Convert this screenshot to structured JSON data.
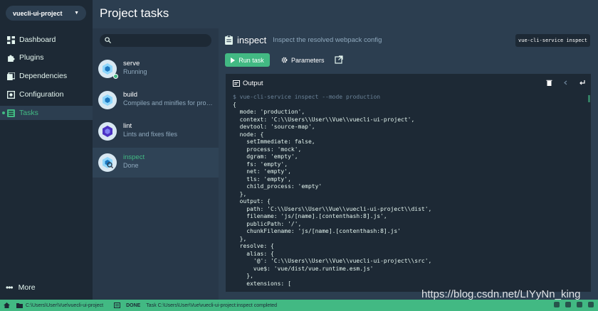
{
  "nav": {
    "project": "vuecli-ui-project",
    "items": [
      {
        "label": "Dashboard",
        "icon": "dashboard-icon"
      },
      {
        "label": "Plugins",
        "icon": "puzzle-icon"
      },
      {
        "label": "Dependencies",
        "icon": "book-icon"
      },
      {
        "label": "Configuration",
        "icon": "settings-icon"
      },
      {
        "label": "Tasks",
        "icon": "tasks-icon",
        "active": true
      }
    ],
    "more": "More"
  },
  "header": {
    "title": "Project tasks"
  },
  "tasks": [
    {
      "name": "serve",
      "desc": "Running"
    },
    {
      "name": "build",
      "desc": "Compiles and minifies for production"
    },
    {
      "name": "lint",
      "desc": "Lints and fixes files"
    },
    {
      "name": "inspect",
      "desc": "Done",
      "selected": true
    }
  ],
  "detail": {
    "name": "inspect",
    "desc": "Inspect the resolved webpack config",
    "command": "vue-cli-service inspect",
    "run_label": "Run task",
    "params_label": "Parameters",
    "output_label": "Output",
    "console": [
      "$ vue-cli-service inspect --mode production",
      "{",
      "  mode: 'production',",
      "  context: 'C:\\\\Users\\\\User\\\\Vue\\\\vuecli-ui-project',",
      "  devtool: 'source-map',",
      "  node: {",
      "    setImmediate: false,",
      "    process: 'mock',",
      "    dgram: 'empty',",
      "    fs: 'empty',",
      "    net: 'empty',",
      "    tls: 'empty',",
      "    child_process: 'empty'",
      "  },",
      "  output: {",
      "    path: 'C:\\\\Users\\\\User\\\\Vue\\\\vuecli-ui-project\\\\dist',",
      "    filename: 'js/[name].[contenthash:8].js',",
      "    publicPath: '/',",
      "    chunkFilename: 'js/[name].[contenthash:8].js'",
      "  },",
      "  resolve: {",
      "    alias: {",
      "      '@': 'C:\\\\Users\\\\User\\\\Vue\\\\vuecli-ui-project\\\\src',",
      "      vue$: 'vue/dist/vue.runtime.esm.js'",
      "    },",
      "    extensions: ["
    ]
  },
  "status": {
    "path": "C:\\Users\\User\\Vue\\vuecli-ui-project",
    "state": "DONE",
    "message": "Task C:\\Users\\User\\Vue\\vuecli-ui-project:inspect completed"
  },
  "watermark": "https://blog.csdn.net/LIYyNn_king",
  "colors": {
    "accent": "#42b983",
    "bg": "#2c3e50",
    "nav": "#1d2935"
  }
}
